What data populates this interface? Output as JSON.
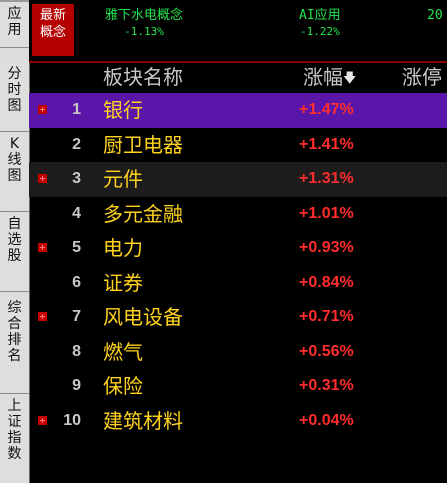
{
  "sidebar": {
    "tabs": [
      {
        "label": "应用"
      },
      {
        "label": "分时图"
      },
      {
        "label": "K线图"
      },
      {
        "label": "自选股"
      },
      {
        "label": "综合排名"
      },
      {
        "label": "上证指数"
      }
    ]
  },
  "concept_bar": {
    "latest_label": "最新概念",
    "items": [
      {
        "name": "雅下水电概念",
        "change": "-1.13%"
      },
      {
        "name": "AI应用",
        "change": "-1.22%"
      },
      {
        "name": "20",
        "change": ""
      }
    ],
    "change_color": "#23e34e"
  },
  "table": {
    "headers": {
      "name": "板块名称",
      "change": "涨幅",
      "limit": "涨停"
    },
    "sort_icon": "arrow-down-icon",
    "rows": [
      {
        "rank": "1",
        "name": "银行",
        "change": "+1.47%",
        "expandable": true
      },
      {
        "rank": "2",
        "name": "厨卫电器",
        "change": "+1.41%",
        "expandable": false
      },
      {
        "rank": "3",
        "name": "元件",
        "change": "+1.31%",
        "expandable": true
      },
      {
        "rank": "4",
        "name": "多元金融",
        "change": "+1.01%",
        "expandable": false
      },
      {
        "rank": "5",
        "name": "电力",
        "change": "+0.93%",
        "expandable": true
      },
      {
        "rank": "6",
        "name": "证券",
        "change": "+0.84%",
        "expandable": false
      },
      {
        "rank": "7",
        "name": "风电设备",
        "change": "+0.71%",
        "expandable": true
      },
      {
        "rank": "8",
        "name": "燃气",
        "change": "+0.56%",
        "expandable": false
      },
      {
        "rank": "9",
        "name": "保险",
        "change": "+0.31%",
        "expandable": false
      },
      {
        "rank": "10",
        "name": "建筑材料",
        "change": "+0.04%",
        "expandable": true
      }
    ],
    "colors": {
      "name": "#ffd21e",
      "up": "#ff2d2d",
      "selected_bg": "#5a16a8"
    }
  }
}
